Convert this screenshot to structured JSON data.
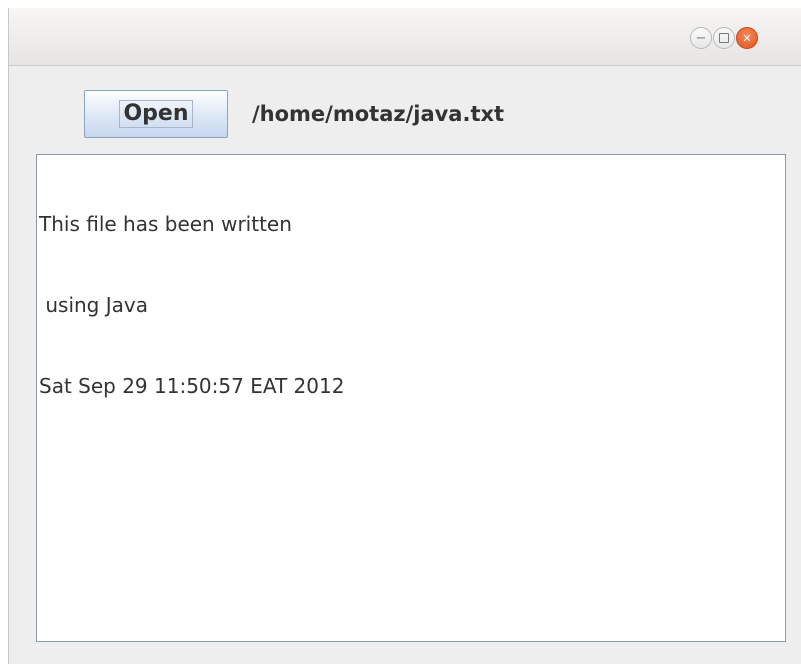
{
  "window": {
    "controls": {
      "minimize_icon": "minus-icon",
      "maximize_icon": "square-icon",
      "close_icon": "x-icon",
      "close_color": "#e2531f"
    }
  },
  "toolbar": {
    "open_label": "Open",
    "file_path": "/home/motaz/java.txt"
  },
  "editor": {
    "lines": [
      "This file has been written",
      " using Java",
      "Sat Sep 29 11:50:57 EAT 2012"
    ]
  }
}
